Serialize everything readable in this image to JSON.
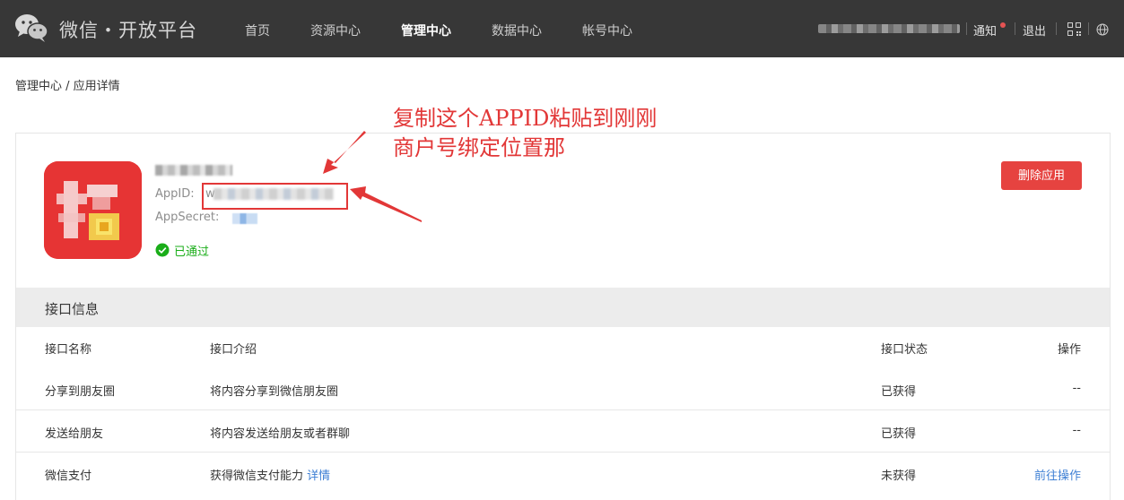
{
  "header": {
    "brand": "微信・开放平台",
    "nav": [
      "首页",
      "资源中心",
      "管理中心",
      "数据中心",
      "帐号中心"
    ],
    "active_nav": "管理中心",
    "notify": "通知",
    "logout": "退出"
  },
  "breadcrumb": "管理中心 / 应用详情",
  "annotation": {
    "line1": "复制这个APPID粘贴到刚刚",
    "line2": "商户号绑定位置那"
  },
  "app": {
    "appid_label": "AppID:",
    "appid_prefix": "w",
    "appsecret_label": "AppSecret:",
    "status": "已通过",
    "delete_button": "删除应用"
  },
  "interfaces": {
    "section_title": "接口信息",
    "columns": [
      "接口名称",
      "接口介绍",
      "接口状态",
      "操作"
    ],
    "rows": [
      {
        "name": "分享到朋友圈",
        "intro": "将内容分享到微信朋友圈",
        "status": "已获得",
        "action": "--"
      },
      {
        "name": "发送给朋友",
        "intro": "将内容发送给朋友或者群聊",
        "status": "已获得",
        "action": "--"
      },
      {
        "name": "微信支付",
        "intro": "获得微信支付能力",
        "intro_link": "详情",
        "status": "未获得",
        "action": "前往操作"
      }
    ]
  },
  "colors": {
    "topbar": "#373737",
    "danger": "#e64340",
    "success": "#1aad19",
    "link": "#3e7fd4",
    "annotation": "#e23737"
  }
}
